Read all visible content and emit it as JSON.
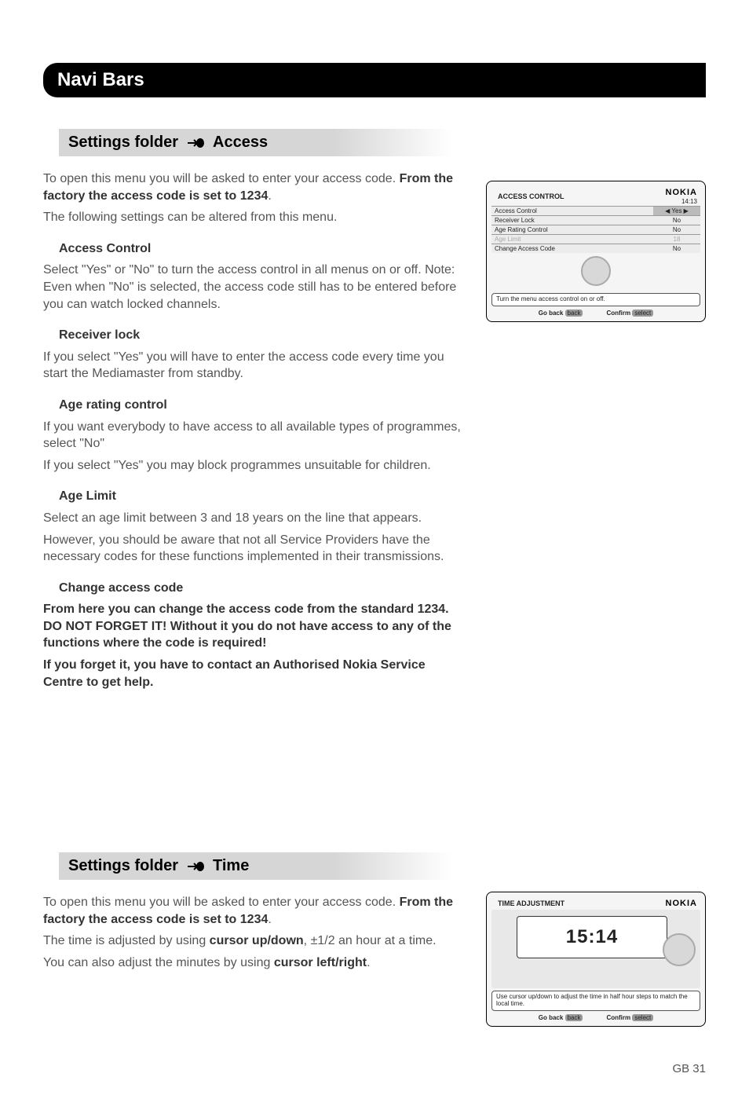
{
  "page": {
    "title_bar": "Navi Bars",
    "page_number": "GB 31"
  },
  "section_access": {
    "heading_prefix": "Settings folder",
    "heading_suffix": "Access",
    "intro_p1_a": "To open this menu you will be asked to enter your access code. ",
    "intro_p1_b": "From the factory the access code is set to 1234",
    "intro_p1_c": ".",
    "intro_p2": "The following settings can be altered from this menu.",
    "h_access_control": "Access Control",
    "p_access_control": "Select \"Yes\" or \"No\" to turn the access control in all menus on or off. Note: Even when \"No\" is selected, the access code still has to be entered before you can watch locked channels.",
    "h_receiver_lock": "Receiver lock",
    "p_receiver_lock": "If you select \"Yes\" you will have to enter the access code every time you start the Mediamaster from standby.",
    "h_age_rating": "Age rating control",
    "p_age_rating_1": "If you want everybody to have access to all available types of programmes, select \"No\"",
    "p_age_rating_2": "If you select \"Yes\" you may block programmes unsuitable for children.",
    "h_age_limit": "Age Limit",
    "p_age_limit_1": "Select an age limit between 3 and 18 years on the line that appears.",
    "p_age_limit_2": "However, you should be aware that not all Service Providers have the necessary codes for these functions implemented in their transmissions.",
    "h_change_code": "Change access code",
    "p_change_code_1": "From here you can change the access code from the standard 1234. DO NOT FORGET IT! Without it you do not have access to any of the functions where the code is required!",
    "p_change_code_2": "If you forget it, you have to contact an Authorised Nokia Service Centre to get help."
  },
  "section_time": {
    "heading_prefix": "Settings folder",
    "heading_suffix": "Time",
    "p1_a": "To open this menu you will be asked to enter your access code. ",
    "p1_b": "From the factory the access code is set to 1234",
    "p1_c": ".",
    "p2_a": "The time is adjusted by using ",
    "p2_b": "cursor up/down",
    "p2_c": ", ±1/2 an hour at a time.",
    "p3_a": "You can also adjust the minutes by using ",
    "p3_b": "cursor left/right",
    "p3_c": "."
  },
  "screenshot1": {
    "brand": "NOKIA",
    "clock": "14:13",
    "title": "ACCESS CONTROL",
    "rows": [
      {
        "label": "Access Control",
        "value": "Yes",
        "sel": true
      },
      {
        "label": "Receiver Lock",
        "value": "No"
      },
      {
        "label": "Age Rating Control",
        "value": "No"
      },
      {
        "label": "Age Limit",
        "value": "18",
        "dis": true
      },
      {
        "label": "Change Access Code",
        "value": "No"
      }
    ],
    "help": "Turn the menu access control on or off.",
    "foot_back": "Go back",
    "foot_back_btn": "back",
    "foot_confirm": "Confirm",
    "foot_confirm_btn": "select"
  },
  "screenshot2": {
    "brand": "NOKIA",
    "title": "TIME ADJUSTMENT",
    "time": "15:14",
    "help": "Use cursor up/down to adjust the time in half hour steps to match the local time.",
    "foot_back": "Go back",
    "foot_back_btn": "back",
    "foot_confirm": "Confirm",
    "foot_confirm_btn": "select"
  }
}
